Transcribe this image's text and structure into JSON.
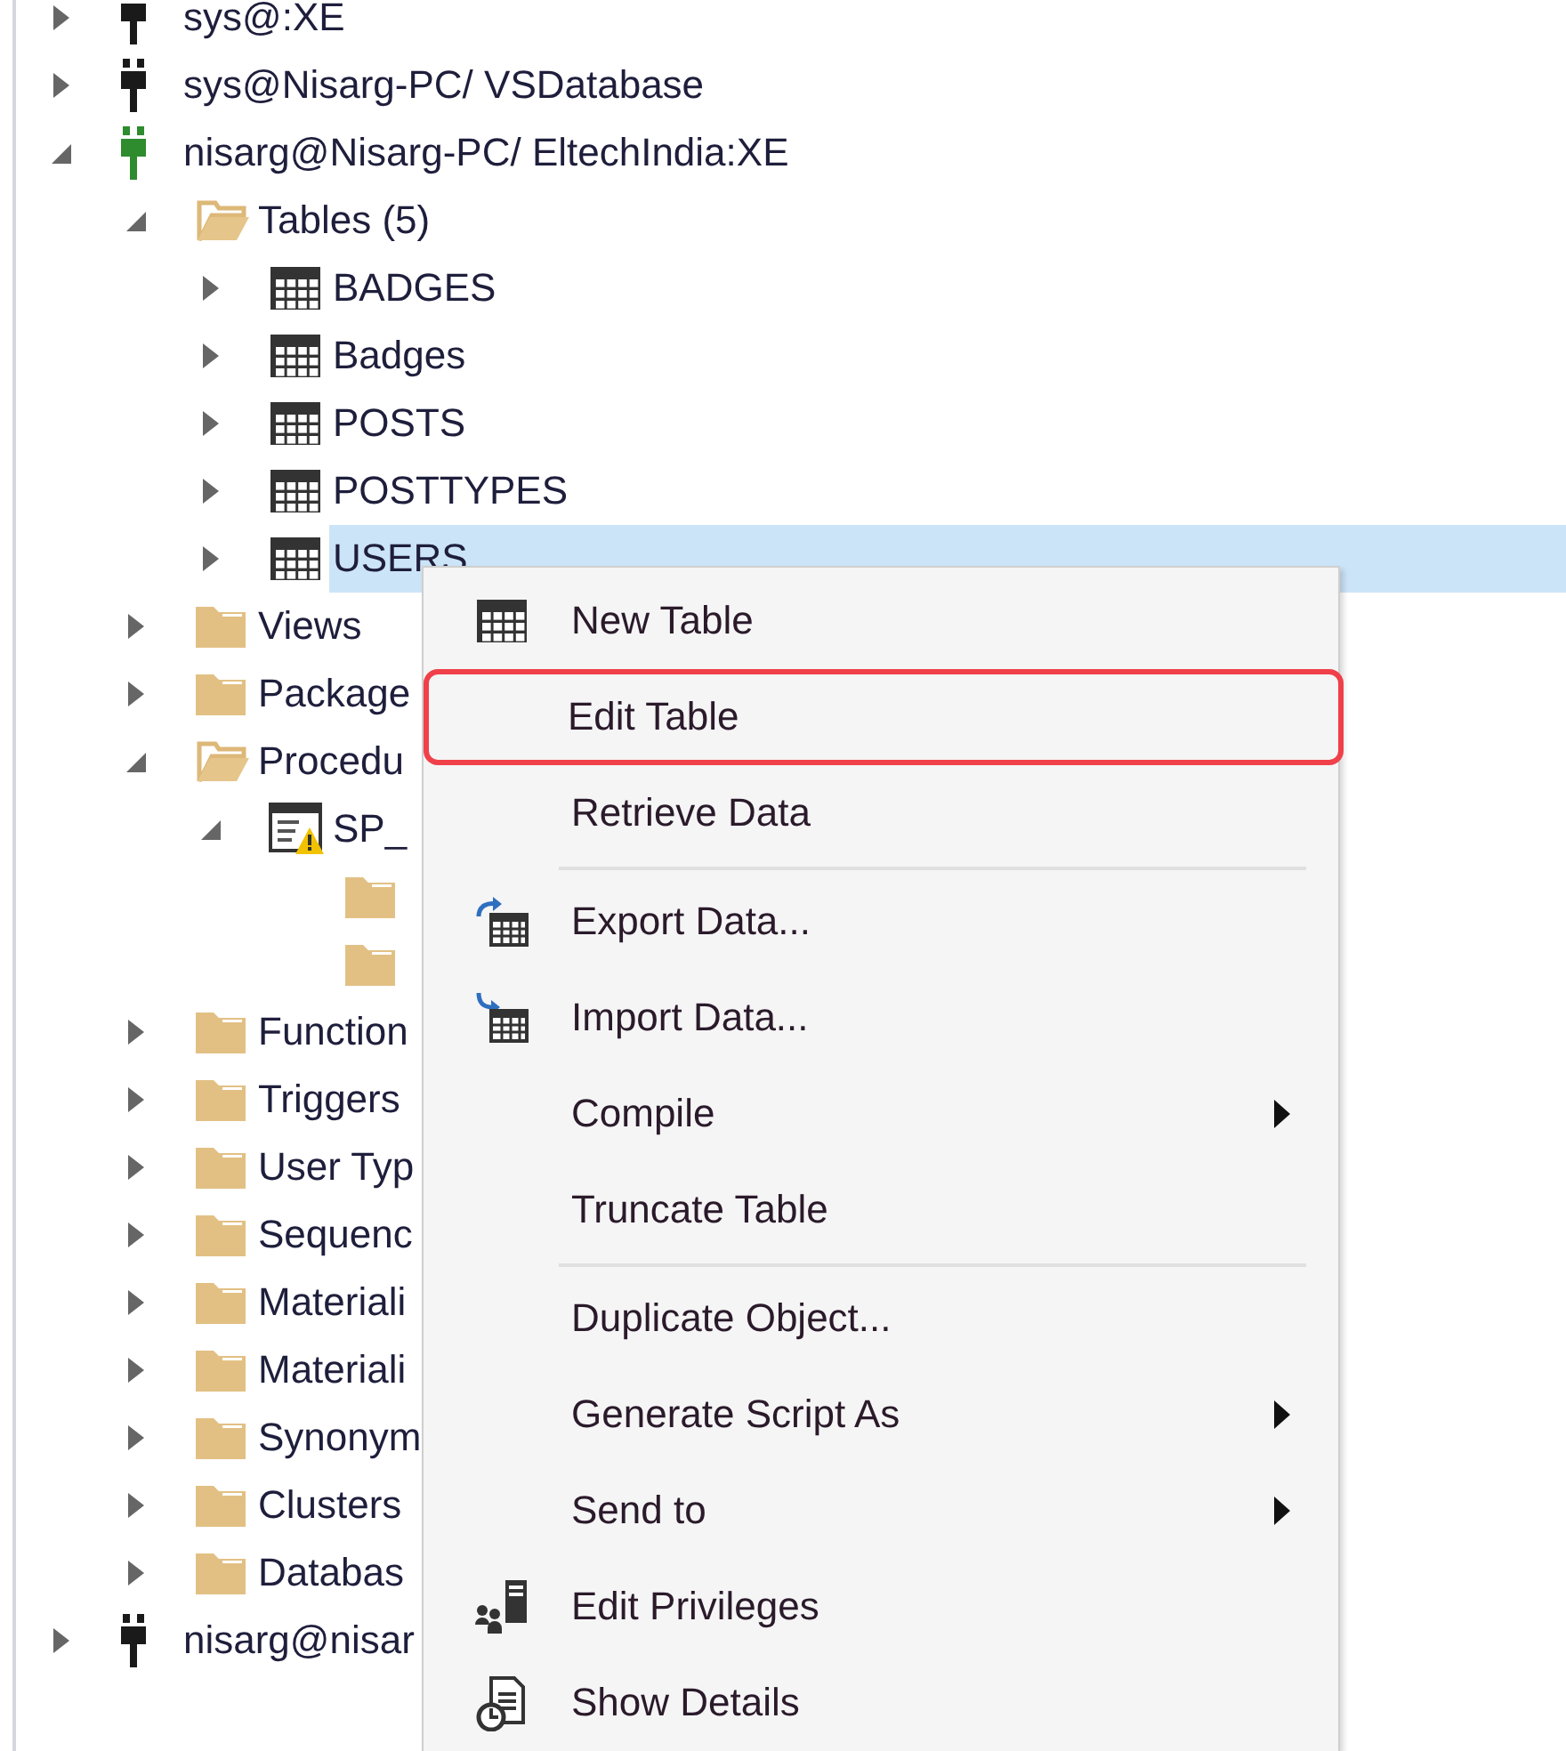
{
  "tree": [
    {
      "label": "sys@:XE",
      "kind": "connection",
      "connected": false,
      "expanded": false
    },
    {
      "label": "sys@Nisarg-PC/ VSDatabase",
      "kind": "connection",
      "connected": false,
      "expanded": false
    },
    {
      "label": "nisarg@Nisarg-PC/ EltechIndia:XE",
      "kind": "connection",
      "connected": true,
      "expanded": true,
      "children": [
        {
          "label": "Tables (5)",
          "kind": "folder",
          "expanded": true,
          "children": [
            {
              "label": "BADGES",
              "kind": "table",
              "expanded": false,
              "selected": false
            },
            {
              "label": "Badges",
              "kind": "table",
              "expanded": false,
              "selected": false
            },
            {
              "label": "POSTS",
              "kind": "table",
              "expanded": false,
              "selected": false
            },
            {
              "label": "POSTTYPES",
              "kind": "table",
              "expanded": false,
              "selected": false
            },
            {
              "label": "USERS",
              "kind": "table",
              "expanded": false,
              "selected": true
            }
          ]
        },
        {
          "label": "Views",
          "kind": "folder",
          "expanded": false
        },
        {
          "label": "Package",
          "kind": "folder",
          "expanded": false
        },
        {
          "label": "Procedu",
          "kind": "folder",
          "expanded": true,
          "children": [
            {
              "label": "SP_",
              "kind": "procedure",
              "expanded": true,
              "children": [
                {
                  "kind": "folder"
                },
                {
                  "kind": "folder"
                }
              ]
            }
          ]
        },
        {
          "label": "Function",
          "kind": "folder",
          "expanded": false
        },
        {
          "label": "Triggers",
          "kind": "folder",
          "expanded": false
        },
        {
          "label": "User Typ",
          "kind": "folder",
          "expanded": false
        },
        {
          "label": "Sequenc",
          "kind": "folder",
          "expanded": false
        },
        {
          "label": "Materiali",
          "kind": "folder",
          "expanded": false
        },
        {
          "label": "Materiali",
          "kind": "folder",
          "expanded": false
        },
        {
          "label": "Synonym",
          "kind": "folder",
          "expanded": false
        },
        {
          "label": "Clusters",
          "kind": "folder",
          "expanded": false
        },
        {
          "label": "Databas",
          "kind": "folder",
          "expanded": false
        }
      ]
    },
    {
      "label": "nisarg@nisar",
      "kind": "connection",
      "connected": false,
      "expanded": false
    }
  ],
  "context_menu": [
    {
      "label": "New Table",
      "highlighted": false
    },
    {
      "label": "Edit Table",
      "highlighted": true
    },
    {
      "label": "Retrieve Data",
      "highlighted": false
    },
    {
      "label": "Export Data...",
      "separator_before": true,
      "highlighted": false
    },
    {
      "label": "Import Data...",
      "highlighted": false
    },
    {
      "label": "Compile",
      "submenu": true,
      "highlighted": false
    },
    {
      "label": "Truncate Table",
      "highlighted": false
    },
    {
      "label": "Duplicate Object...",
      "separator_before": true,
      "highlighted": false
    },
    {
      "label": "Generate Script As",
      "submenu": true,
      "highlighted": false
    },
    {
      "label": "Send to",
      "submenu": true,
      "highlighted": false
    },
    {
      "label": "Edit Privileges",
      "highlighted": false
    },
    {
      "label": "Show Details",
      "highlighted": false
    }
  ]
}
